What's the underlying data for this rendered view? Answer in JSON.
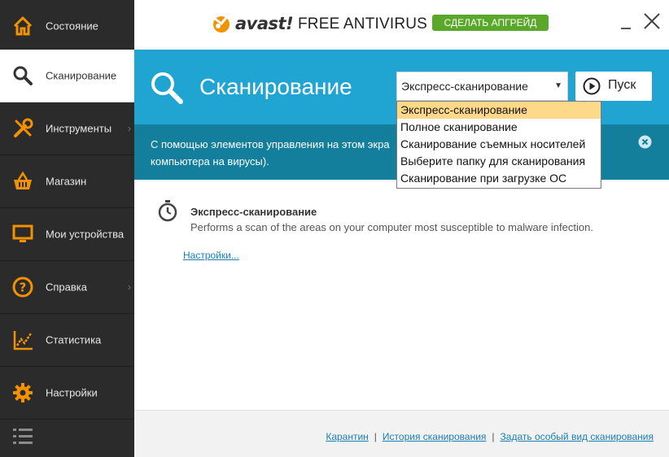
{
  "app": {
    "brand": "avast!",
    "product": "FREE ANTIVIRUS",
    "upgrade_label": "СДЕЛАТЬ АПГРЕЙД"
  },
  "sidebar": {
    "items": [
      {
        "label": "Состояние",
        "icon": "home-icon"
      },
      {
        "label": "Сканирование",
        "icon": "search-icon",
        "active": true
      },
      {
        "label": "Инструменты",
        "icon": "tools-icon",
        "has_submenu": true
      },
      {
        "label": "Магазин",
        "icon": "basket-icon"
      },
      {
        "label": "Мои устройства",
        "icon": "monitor-icon"
      },
      {
        "label": "Справка",
        "icon": "help-icon",
        "has_submenu": true
      },
      {
        "label": "Статистика",
        "icon": "chart-icon"
      },
      {
        "label": "Настройки",
        "icon": "gear-icon"
      }
    ]
  },
  "header": {
    "title": "Сканирование",
    "scan_select": {
      "value": "Экспресс-сканирование",
      "options": [
        "Экспресс-сканирование",
        "Полное сканирование",
        "Сканирование съемных носителей",
        "Выберите папку для сканирования",
        "Сканирование при загрузке ОС"
      ]
    },
    "start_label": "Пуск"
  },
  "info": {
    "text_line1": "С помощью элементов управления на этом экра",
    "text_line2": "компьютера на вирусы)."
  },
  "content": {
    "scan_name": "Экспресс-сканирование",
    "scan_description": "Performs a scan of the areas on your computer most susceptible to malware infection.",
    "settings_link": "Настройки..."
  },
  "footer": {
    "quarantine": "Карантин",
    "history": "История сканирования",
    "custom_scan": "Задать особый вид сканирования",
    "separator": "|"
  },
  "colors": {
    "sidebar_bg": "#2b2b2b",
    "accent_orange": "#f39200",
    "header_blue": "#20a5d3",
    "info_teal": "#137f9c",
    "upgrade_green": "#5aa829",
    "link_blue": "#1a7fb5",
    "dropdown_highlight": "#ffd98a"
  }
}
